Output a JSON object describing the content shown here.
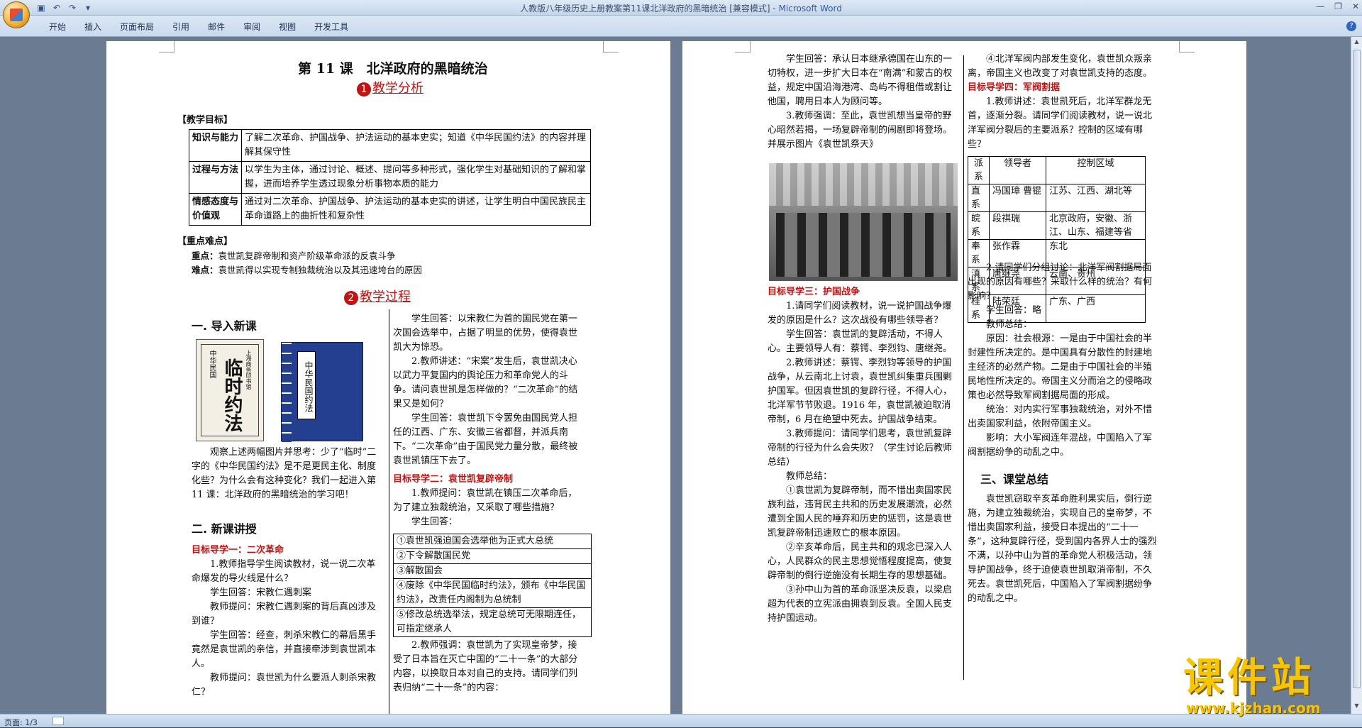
{
  "window": {
    "title": "人教版八年级历史上册教案第11课北洋政府的黑暗统治 [兼容模式] - ",
    "app": "Microsoft Word"
  },
  "ribbon": {
    "tabs": [
      "开始",
      "插入",
      "页面布局",
      "引用",
      "邮件",
      "审阅",
      "视图",
      "开发工具"
    ]
  },
  "status": {
    "page": "页面: 1/3"
  },
  "watermark": {
    "brand": "课件站",
    "url": "www.kjzhan.com"
  },
  "page1": {
    "title": "第 11 课　北洋政府的黑暗统治",
    "section1": {
      "num": "1",
      "label": "教学分析"
    },
    "objectives_heading": "【教学目标】",
    "objectives": [
      {
        "k": "知识与能力",
        "v": "了解二次革命、护国战争、护法运动的基本史实；知道《中华民国约法》的内容并理解其保守性"
      },
      {
        "k": "过程与方法",
        "v": "以学生为主体，通过讨论、概述、提问等多种形式，强化学生对基础知识的了解和掌握，进而培养学生透过现象分析事物本质的能力"
      },
      {
        "k": "情感态度与价值观",
        "v": "通过对二次革命、护国战争、护法运动的基本史实的讲述，让学生明白中国民族民主革命道路上的曲折性和复杂性"
      }
    ],
    "keypoints_heading": "【重点难点】",
    "key_label": "重点：",
    "key_text": "袁世凯复辟帝制和资产阶级革命派的反袁斗争",
    "diff_label": "难点：",
    "diff_text": "袁世凯得以实现专制独裁统治以及其迅速垮台的原因",
    "section2": {
      "num": "2",
      "label": "教学过程"
    },
    "h_intro": "一. 导入新课",
    "book1": {
      "top": "中华民国",
      "main": "临时约法",
      "side": "上海商务印书馆"
    },
    "book2": {
      "label": "中华民国约法"
    },
    "intro_text": "　　观察上述两幅图片并思考：少了“临时”二字的《中华民国约法》是不是更民主化、制度化些？为什么会有这种变化？我们一起进入第 11 课：北洋政府的黑暗统治的学习吧！",
    "h_new": "二. 新课讲授",
    "goal1": "目标导学一：二次革命",
    "left_lines": [
      "　　1.教师指导学生阅读教材，说一说二次革命爆发的导火线是什么？",
      "　　学生回答：宋教仁遇刺案",
      "　　教师提问：宋教仁遇刺案的背后真凶涉及到谁？",
      "　　学生回答：经查，刺杀宋教仁的幕后黑手竟然是袁世凯的亲信，并直接牵涉到袁世凯本人。",
      "　　教师提问：袁世凯为什么要派人刺杀宋教仁？"
    ],
    "right_lines": [
      "　　学生回答：以宋教仁为首的国民党在第一次国会选举中，占据了明显的优势，使得袁世凯大为惊恐。",
      "　　2.教师讲述：“宋案”发生后，袁世凯决心以武力平复国内的舆论压力和革命党人的斗争。请问袁世凯是怎样做的？“二次革命”的结果又是如何？",
      "　　学生回答：袁世凯下令罢免由国民党人担任的江西、广东、安徽三省都督，并派兵南下。“二次革命”由于国民党力量分散，最终被袁世凯镇压下去了。"
    ],
    "goal2": "目标导学二：袁世凯复辟帝制",
    "right_lines2": [
      "　　1.教师提问：袁世凯在镇压二次革命后，为了建立独裁统治，又采取了哪些措施？",
      "　　学生回答："
    ],
    "measures": [
      "①袁世凯强迫国会选举他为正式大总统",
      "②下令解散国民党",
      "③解散国会",
      "④废除《中华民国临时约法》，颁布《中华民国约法》，改责任内阁制为总统制",
      "⑤修改总统选举法，规定总统可无限期连任，可指定继承人"
    ],
    "right_lines3": "　　2.教师强调：袁世凯为了实现皇帝梦，接受了日本旨在灭亡中国的“二十一条”的大部分内容，以换取日本对自己的支持。请同学们列表归纳“二十一条”的内容："
  },
  "page2": {
    "colA_1": "　　学生回答：承认日本继承德国在山东的一切特权，进一步扩大日本在“南满”和蒙古的权益，规定中国沿海港湾、岛屿不得租借或割让他国，聘用日本人为顾问等。",
    "colA_2": "　　3.教师强调：至此，袁世凯想当皇帝的野心昭然若揭，一场复辟帝制的闹剧即将登场。并展示图片《袁世凯祭天》",
    "goal3": "目标导学三：护国战争",
    "colA_3": [
      "　　1.请同学们阅读教材，说一说护国战争爆发的原因是什么？这次战役有哪些领导者？",
      "　　学生回答：袁世凯的复辟活动，不得人心。主要领导人有：蔡锷、李烈钧、唐继尧。",
      "　　2.教师讲述：蔡锷、李烈钧等领导的护国战争，从云南北上讨袁，袁世凯纠集重兵围剿护国军。但因袁世凯的复辟行径，不得人心，北洋军节节败退。1916 年，袁世凯被迫取消帝制，6 月在绝望中死去。护国战争结束。",
      "　　3.教师提问：请同学们思考，袁世凯复辟帝制的行径为什么会失败？（学生讨论后教师总结）",
      "　　教师总结：",
      "　　①袁世凯为复辟帝制，而不惜出卖国家民族利益，违背民主共和的历史发展潮流，必然遭到全国人民的唾弃和历史的惩罚，这是袁世凯复辟帝制迅速败亡的根本原因。",
      "　　②辛亥革命后，民主共和的观念已深入人心，人民群众的民主思想觉悟程度提高，使复辟帝制的倒行逆施没有长期生存的思想基础。",
      "　　③孙中山为首的革命派坚决反袁，以梁启超为代表的立宪派由拥袁到反袁。全国人民支持护国运动。"
    ],
    "colB_1": "　　④北洋军阀内部发生变化，袁世凯众叛亲离，帝国主义也改变了对袁世凯支持的态度。",
    "goal4": "目标导学四：军阀割据",
    "colB_2": "　　1.教师讲述：袁世凯死后，北洋军群龙无首，逐渐分裂。请同学们阅读教材，说一说北洋军阀分裂后的主要派系？控制的区域有哪些？",
    "warlords": {
      "header": [
        "派系",
        "领导者",
        "控制区域"
      ],
      "rows": [
        [
          "直系",
          "冯国璋 曹锟",
          "江苏、江西、湖北等"
        ],
        [
          "皖系",
          "段祺瑞",
          "北京政府，安徽、浙江、山东、福建等省"
        ],
        [
          "奉系",
          "张作霖",
          "东北"
        ],
        [
          "滇系",
          "唐继尧",
          "云南、贵州"
        ],
        [
          "桂系",
          "陆荣廷",
          "广东、广西"
        ]
      ]
    },
    "colB_3": [
      "　　2.请同学们分组讨论：北洋军阀割据局面出现的原因有哪些？采取什么样的统治？有何影响？",
      "　　学生回答：略",
      "　　教师总结：",
      "　　原因：社会根源：一是由于中国社会的半封建性所决定的。是中国具有分散性的封建地主经济的必然产物。二是由于中国社会的半殖民地性所决定的。帝国主义分而治之的侵略政策也必然导致军阀割据局面的形成。",
      "　　统治：对内实行军事独裁统治，对外不惜出卖国家利益，依附帝国主义。",
      "　　影响：大小军阀连年混战，中国陷入了军阀割据纷争的动乱之中。"
    ],
    "h_sum": "三、课堂总结",
    "summary": "　　袁世凯窃取辛亥革命胜利果实后，倒行逆施，为建立独裁统治，实现自己的皇帝梦，不惜出卖国家利益，接受日本提出的“二十一条”，这种复辟行径，受到国内各界人士的强烈不满，以孙中山为首的革命党人积极活动，领导护国战争，终于迫使袁世凯取消帝制，不久死去。袁世凯死后，中国陷入了军阀割据纷争的动乱之中。"
  },
  "colors": {
    "accent": "#c01414",
    "ribbon": "#c9daee",
    "workspace": "#6b7c92"
  }
}
